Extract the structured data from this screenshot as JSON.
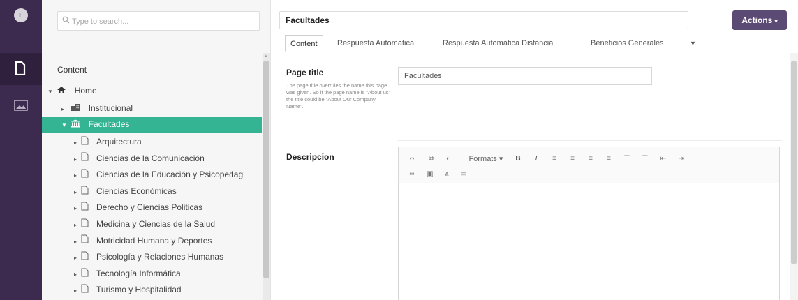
{
  "user": {
    "initial": "L"
  },
  "search": {
    "placeholder": "Type to search..."
  },
  "tree": {
    "header": "Content",
    "home": "Home",
    "institucional": "Institucional",
    "selected": "Facultades",
    "children": [
      "Arquitectura",
      "Ciencias de la Comunicación",
      "Ciencias de la Educación y Psicopedag",
      "Ciencias Económicas",
      "Derecho y Ciencias Politicas",
      "Medicina y Ciencias de la Salud",
      "Motricidad Humana y Deportes",
      "Psicología y Relaciones Humanas",
      "Tecnología Informática",
      "Turismo y Hospitalidad"
    ]
  },
  "header": {
    "node_name": "Facultades",
    "actions_label": "Actions"
  },
  "tabs": [
    "Content",
    "Respuesta Automatica",
    "Respuesta Automática Distancia",
    "Beneficios Generales"
  ],
  "page_title": {
    "label": "Page title",
    "help": "The page title overrules the name this page was given. So if the page name is \"About us\" the title could be \"About Our Company Name\".",
    "value": "Facultades"
  },
  "descripcion": {
    "label": "Descripcion",
    "formats_label": "Formats"
  },
  "colors": {
    "rail": "#3d2a4f",
    "selected": "#35b494",
    "actions": "#5b4a73"
  }
}
